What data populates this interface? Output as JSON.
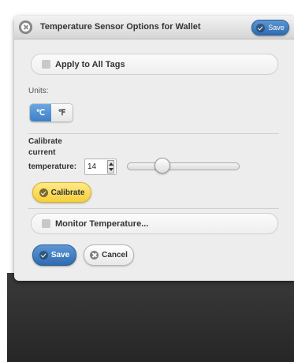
{
  "dialog": {
    "title": "Temperature Sensor Options for Wallet",
    "header_save_label": "Save"
  },
  "apply_all": {
    "label": "Apply to All Tags",
    "checked": false
  },
  "units": {
    "label": "Units:",
    "options": [
      "℃",
      "℉"
    ],
    "selected": "℃"
  },
  "calibrate": {
    "label_line1": "Calibrate",
    "label_line2": "current",
    "label_line3": "temperature:",
    "value": "14",
    "button_label": "Calibrate"
  },
  "monitor": {
    "label": "Monitor Temperature...",
    "checked": false
  },
  "footer": {
    "save_label": "Save",
    "cancel_label": "Cancel"
  },
  "colors": {
    "primary_blue": "#3d7fc6",
    "calibrate_yellow": "#f5cf3a",
    "dialog_bg": "#ededed"
  }
}
